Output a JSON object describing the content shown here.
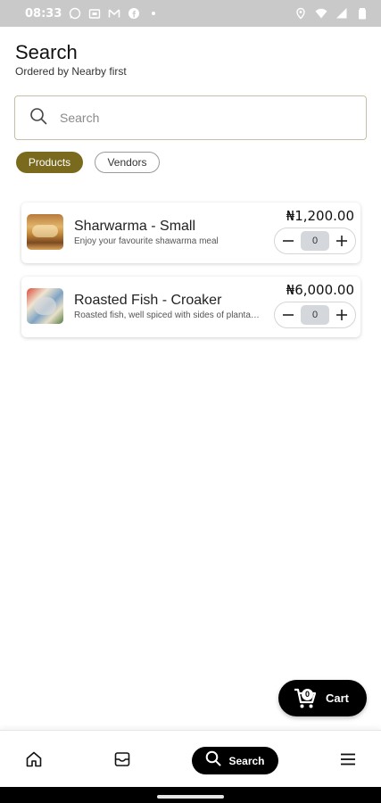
{
  "status_bar": {
    "time": "08:33",
    "left_icons": [
      "whatsapp-icon",
      "store-icon",
      "gmail-icon",
      "facebook-icon",
      "dot-icon"
    ],
    "right_icons": [
      "location-icon",
      "wifi-icon",
      "signal-icon",
      "battery-icon"
    ]
  },
  "header": {
    "title": "Search",
    "subtitle": "Ordered by Nearby first"
  },
  "search": {
    "placeholder": "Search",
    "value": ""
  },
  "filters": {
    "chips": [
      {
        "label": "Products",
        "active": true
      },
      {
        "label": "Vendors",
        "active": false
      }
    ]
  },
  "products": [
    {
      "name": "Sharwarma - Small",
      "description": "Enjoy your favourite shawarma meal",
      "price": "₦1,200.00",
      "quantity": "0",
      "image": "shawarma-image"
    },
    {
      "name": "Roasted Fish - Croaker",
      "description": "Roasted fish, well spiced with sides of plantain, ...",
      "price": "₦6,000.00",
      "quantity": "0",
      "image": "fish-image"
    }
  ],
  "cart": {
    "label": "Cart",
    "count": "0"
  },
  "bottom_nav": {
    "items": [
      {
        "icon": "home-icon",
        "label": ""
      },
      {
        "icon": "orders-icon",
        "label": ""
      },
      {
        "icon": "search-icon",
        "label": "Search",
        "active": true
      },
      {
        "icon": "menu-icon",
        "label": ""
      }
    ]
  },
  "colors": {
    "accent": "#7a6a1e",
    "search_border": "#c5bfa6",
    "dark": "#000000"
  }
}
